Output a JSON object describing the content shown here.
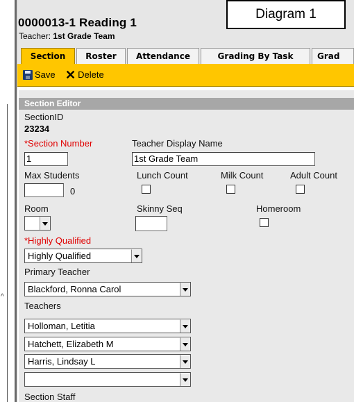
{
  "header": {
    "title": "0000013-1 Reading 1",
    "teacher_label": "Teacher:",
    "teacher_value": "1st Grade Team"
  },
  "annotation": {
    "label": "Diagram 1"
  },
  "tabs": [
    "Section",
    "Roster",
    "Attendance",
    "Grading By Task",
    "Grad"
  ],
  "active_tab": "Section",
  "toolbar": {
    "save": "Save",
    "delete": "Delete"
  },
  "editor": {
    "title": "Section Editor",
    "section_id_label": "SectionID",
    "section_id_value": "23234",
    "section_number_label": "*Section Number",
    "section_number_value": "1",
    "teacher_display_name_label": "Teacher Display Name",
    "teacher_display_name_value": "1st Grade Team",
    "max_students_label": "Max Students",
    "max_students_value": "",
    "max_students_count": "0",
    "lunch_count_label": "Lunch Count",
    "milk_count_label": "Milk Count",
    "adult_count_label": "Adult Count",
    "room_label": "Room",
    "room_value": "",
    "skinny_seq_label": "Skinny Seq",
    "skinny_seq_value": "",
    "homeroom_label": "Homeroom",
    "highly_qualified_label": "*Highly Qualified",
    "highly_qualified_value": "Highly Qualified",
    "primary_teacher_label": "Primary Teacher",
    "primary_teacher_value": "Blackford, Ronna Carol",
    "teachers_label": "Teachers",
    "teachers": [
      "Holloman, Letitia",
      "Hatchett, Elizabeth M",
      "Harris, Lindsay L",
      ""
    ],
    "section_staff_label": "Section Staff"
  },
  "checkboxes": {
    "lunch_count": false,
    "milk_count": false,
    "adult_count": false,
    "homeroom": false
  },
  "colors": {
    "accent": "#ffc600",
    "header_bg": "#e6e6e6",
    "panel_bg": "#e9e9e9",
    "section_head_bg": "#a7a7a7",
    "required_text": "#e00000"
  },
  "icons": [
    "save-icon",
    "delete-x-icon",
    "dropdown-arrow-icon"
  ]
}
